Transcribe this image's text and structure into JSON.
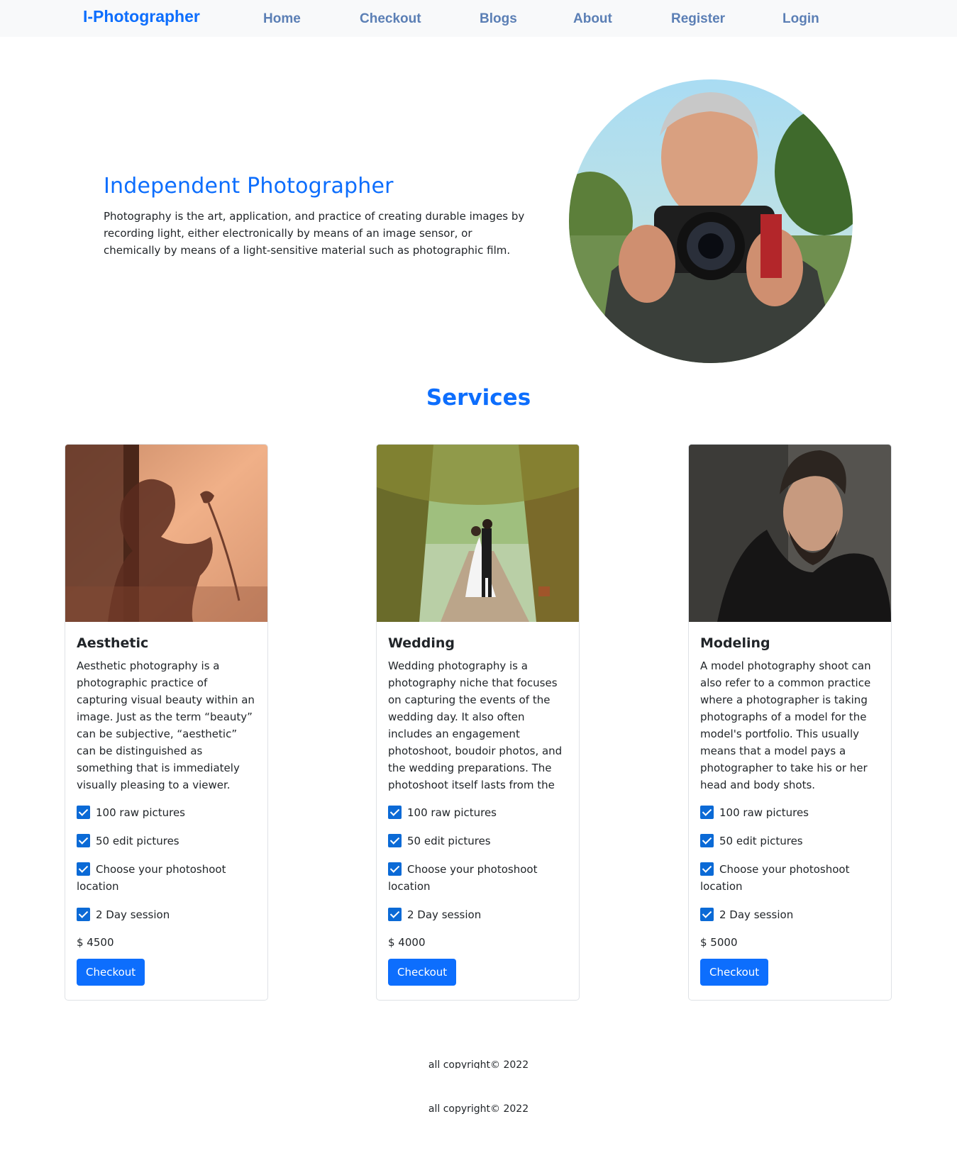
{
  "nav": {
    "brand": "I-Photographer",
    "links": [
      "Home",
      "Checkout",
      "Blogs",
      "About",
      "Register",
      "Login"
    ]
  },
  "hero": {
    "title": "Independent Photographer",
    "text": "Photography is the art, application, and practice of creating durable images by recording light, either electronically by means of an image sensor, or chemically by means of a light-sensitive material such as photographic film."
  },
  "services": {
    "title": "Services",
    "cards": [
      {
        "title": "Aesthetic",
        "text": "Aesthetic photography is a photographic practice of capturing visual beauty within an image. Just as the term “beauty” can be subjective, “aesthetic” can be distinguished as something that is immediately visually pleasing to a viewer.",
        "features": [
          "100 raw pictures",
          "50 edit pictures",
          "Choose your photoshoot location",
          "2 Day session"
        ],
        "price": "$ 4500",
        "button": "Checkout"
      },
      {
        "title": "Wedding",
        "text": "Wedding photography is a photography niche that focuses on capturing the events of the wedding day. It also often includes an engagement photoshoot, boudoir photos, and the wedding preparations. The photoshoot itself lasts from the beginning of the",
        "features": [
          "100 raw pictures",
          "50 edit pictures",
          "Choose your photoshoot location",
          "2 Day session"
        ],
        "price": "$ 4000",
        "button": "Checkout"
      },
      {
        "title": "Modeling",
        "text": "A model photography shoot can also refer to a common practice where a photographer is taking photographs of a model for the model's portfolio. This usually means that a model pays a photographer to take his or her head and body shots.",
        "features": [
          "100 raw pictures",
          "50 edit pictures",
          "Choose your photoshoot location",
          "2 Day session"
        ],
        "price": "$ 5000",
        "button": "Checkout"
      }
    ]
  },
  "footer": {
    "copyright_clipped": "all copyright© 2022",
    "copyright": "all copyright© 2022"
  },
  "colors": {
    "accent": "#0d6efd",
    "nav_link": "#5b7fb5",
    "navbar_bg": "#f8f9fa",
    "checkbox": "#0b6ad6"
  }
}
